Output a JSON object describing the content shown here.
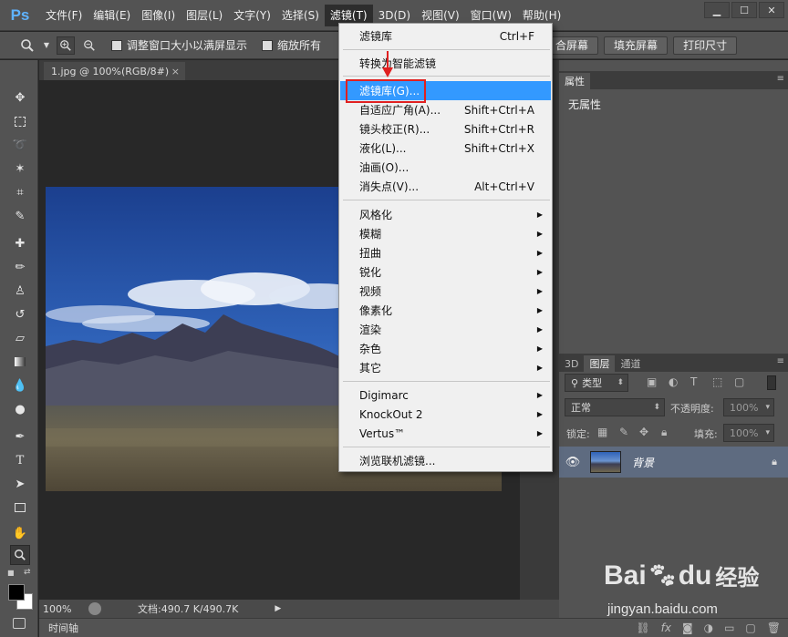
{
  "app": {
    "logo": "Ps"
  },
  "menubar": {
    "items": [
      "文件(F)",
      "编辑(E)",
      "图像(I)",
      "图层(L)",
      "文字(Y)",
      "选择(S)",
      "滤镜(T)",
      "3D(D)",
      "视图(V)",
      "窗口(W)",
      "帮助(H)"
    ],
    "active_index": 6
  },
  "window_controls": {
    "minimize": "▁",
    "restore": "☐",
    "close": "✕"
  },
  "options_bar": {
    "resize_windows_label": "调整窗口大小以满屏显示",
    "zoom_all_label": "缩放所有",
    "fit_screen_label": "合屏幕",
    "fill_screen_label": "填充屏幕",
    "print_size_label": "打印尺寸"
  },
  "document": {
    "tab_title": "1.jpg @ 100%(RGB/8#)",
    "close_glyph": "×",
    "zoom": "100%",
    "doc_info": "文档:490.7 K/490.7K"
  },
  "timeline": {
    "label": "时间轴"
  },
  "properties_panel": {
    "tab_label": "属性",
    "content": "无属性"
  },
  "layers_panel": {
    "tabs": [
      "3D",
      "图层",
      "通道"
    ],
    "active_tab": 1,
    "filter_kind": "类型",
    "blend_mode": "正常",
    "opacity_label": "不透明度:",
    "opacity_value": "100%",
    "lock_label": "锁定:",
    "fill_label": "填充:",
    "fill_value": "100%",
    "layers": [
      {
        "name": "背景",
        "visible": true,
        "locked": true
      }
    ]
  },
  "filter_menu": {
    "items": [
      {
        "label": "滤镜库",
        "shortcut": "Ctrl+F"
      },
      {
        "label": "转换为智能滤镜",
        "shortcut": ""
      },
      {
        "label": "滤镜库(G)...",
        "shortcut": "",
        "highlighted": true
      },
      {
        "label": "自适应广角(A)...",
        "shortcut": "Shift+Ctrl+A"
      },
      {
        "label": "镜头校正(R)...",
        "shortcut": "Shift+Ctrl+R"
      },
      {
        "label": "液化(L)...",
        "shortcut": "Shift+Ctrl+X"
      },
      {
        "label": "油画(O)...",
        "shortcut": ""
      },
      {
        "label": "消失点(V)...",
        "shortcut": "Alt+Ctrl+V"
      },
      {
        "label": "风格化",
        "submenu": true
      },
      {
        "label": "模糊",
        "submenu": true
      },
      {
        "label": "扭曲",
        "submenu": true
      },
      {
        "label": "锐化",
        "submenu": true
      },
      {
        "label": "视频",
        "submenu": true
      },
      {
        "label": "像素化",
        "submenu": true
      },
      {
        "label": "渲染",
        "submenu": true
      },
      {
        "label": "杂色",
        "submenu": true
      },
      {
        "label": "其它",
        "submenu": true
      },
      {
        "label": "Digimarc",
        "submenu": true
      },
      {
        "label": "KnockOut 2",
        "submenu": true
      },
      {
        "label": "Vertus™",
        "submenu": true
      },
      {
        "label": "浏览联机滤镜...",
        "shortcut": ""
      }
    ],
    "submenu_glyph": "▶"
  },
  "watermark": {
    "brand": "Bai",
    "brand2": "du",
    "cn": "经验",
    "url": "jingyan.baidu.com"
  },
  "colors": {
    "highlight": "#3399ff",
    "annotation_red": "#e02020",
    "accent_blue": "#5fb3ff"
  }
}
